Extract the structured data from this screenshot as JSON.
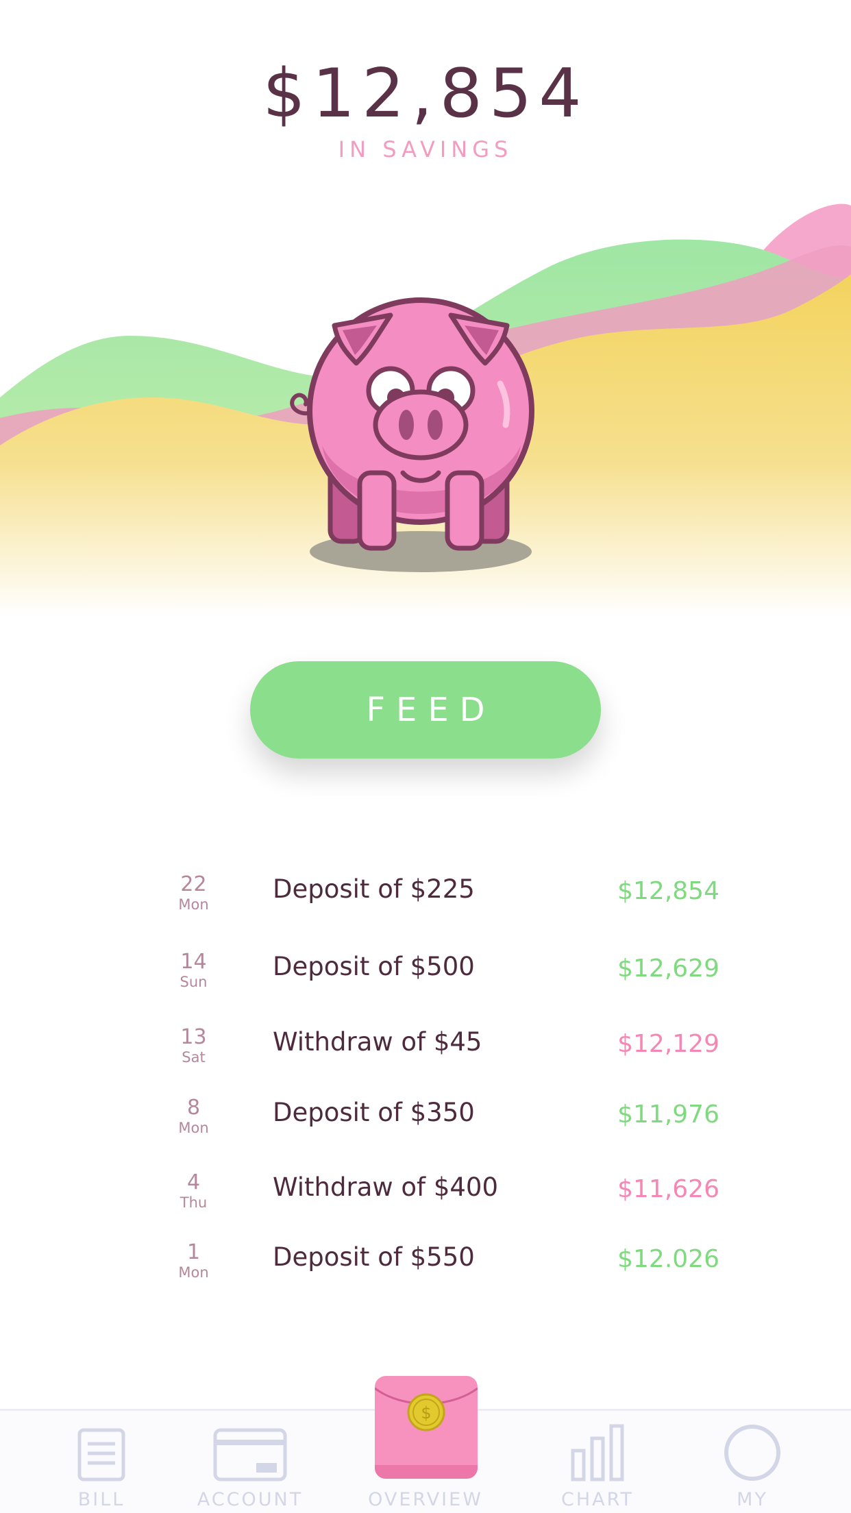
{
  "header": {
    "balance": "$12,854",
    "caption": "IN SAVINGS"
  },
  "hero": {
    "illustration": "piggy-bank-icon",
    "wave_colors": [
      "#a0e6a4",
      "#f5a8cc",
      "#f3d86a"
    ]
  },
  "feed_button": {
    "label": "FEED",
    "color": "#8ade8c"
  },
  "transactions": [
    {
      "day": "22",
      "weekday": "Mon",
      "description": "Deposit of $225",
      "balance": "$12,854",
      "type": "deposit"
    },
    {
      "day": "14",
      "weekday": "Sun",
      "description": "Deposit of $500",
      "balance": "$12,629",
      "type": "deposit"
    },
    {
      "day": "13",
      "weekday": "Sat",
      "description": "Withdraw of $45",
      "balance": "$12,129",
      "type": "withdraw"
    },
    {
      "day": "8",
      "weekday": "Mon",
      "description": "Deposit of $350",
      "balance": "$11,976",
      "type": "deposit"
    },
    {
      "day": "4",
      "weekday": "Thu",
      "description": "Withdraw of $400",
      "balance": "$11,626",
      "type": "withdraw"
    },
    {
      "day": "1",
      "weekday": "Mon",
      "description": "Deposit of $550",
      "balance": "$12.026",
      "type": "deposit"
    }
  ],
  "colors": {
    "deposit": "#7fd97e",
    "withdraw": "#f587b4",
    "text_dark": "#4d2b3c",
    "accent_pink": "#f792be"
  },
  "tabbar": {
    "items": [
      {
        "label": "BILL",
        "icon": "bill-icon"
      },
      {
        "label": "ACCOUNT",
        "icon": "credit-card-icon"
      },
      {
        "label": "OVERVIEW",
        "icon": "red-envelope-coin-icon",
        "active": true
      },
      {
        "label": "CHART",
        "icon": "bar-chart-icon"
      },
      {
        "label": "MY",
        "icon": "profile-circle-icon"
      }
    ],
    "coin_symbol": "$"
  }
}
